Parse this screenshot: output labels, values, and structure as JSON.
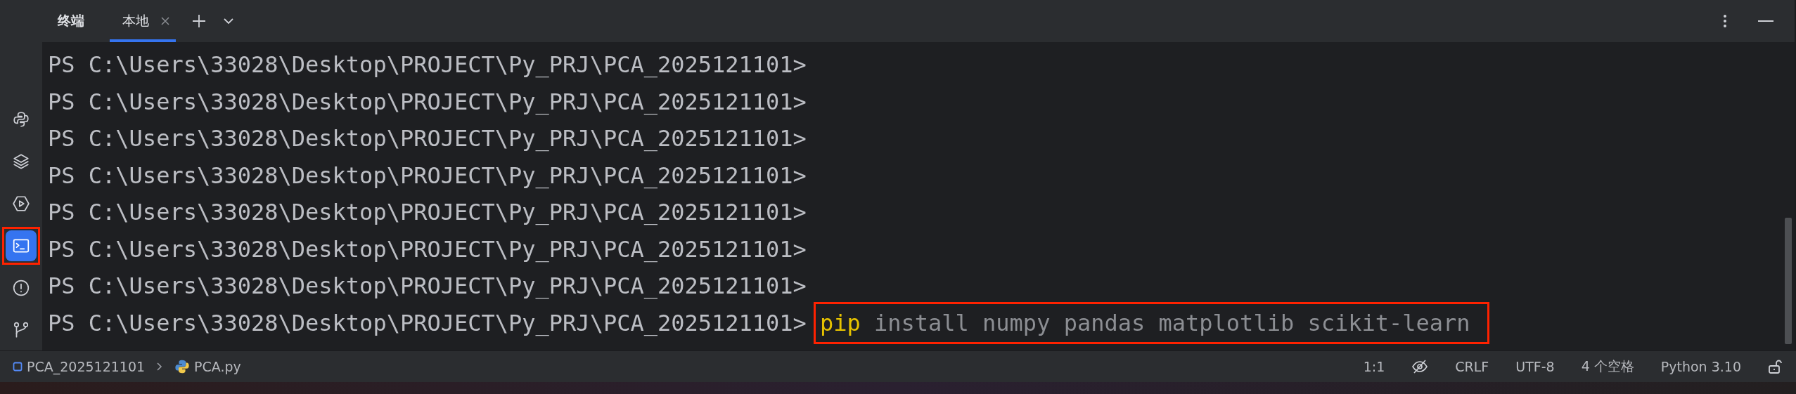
{
  "sidebar": {
    "items": [
      {
        "kind": "python",
        "selected": false
      },
      {
        "kind": "layers",
        "selected": false
      },
      {
        "kind": "run",
        "selected": false
      },
      {
        "kind": "terminal",
        "selected": true,
        "highlighted": true
      },
      {
        "kind": "problems",
        "selected": false
      },
      {
        "kind": "git",
        "selected": false
      }
    ]
  },
  "panel": {
    "title": "终端",
    "tabs": [
      {
        "label": "本地",
        "selected": true,
        "closable": true
      }
    ]
  },
  "terminal": {
    "lines": [
      {
        "prompt": "PS C:\\Users\\33028\\Desktop\\PROJECT\\Py_PRJ\\PCA_2025121101>"
      },
      {
        "prompt": "PS C:\\Users\\33028\\Desktop\\PROJECT\\Py_PRJ\\PCA_2025121101>"
      },
      {
        "prompt": "PS C:\\Users\\33028\\Desktop\\PROJECT\\Py_PRJ\\PCA_2025121101>"
      },
      {
        "prompt": "PS C:\\Users\\33028\\Desktop\\PROJECT\\Py_PRJ\\PCA_2025121101>"
      },
      {
        "prompt": "PS C:\\Users\\33028\\Desktop\\PROJECT\\Py_PRJ\\PCA_2025121101>"
      },
      {
        "prompt": "PS C:\\Users\\33028\\Desktop\\PROJECT\\Py_PRJ\\PCA_2025121101>"
      },
      {
        "prompt": "PS C:\\Users\\33028\\Desktop\\PROJECT\\Py_PRJ\\PCA_2025121101>"
      },
      {
        "prompt": "PS C:\\Users\\33028\\Desktop\\PROJECT\\Py_PRJ\\PCA_2025121101>",
        "command": {
          "program": "pip",
          "args": "install numpy pandas matplotlib scikit-learn"
        },
        "highlighted": true
      }
    ]
  },
  "status_bar": {
    "breadcrumb": [
      {
        "kind": "project",
        "label": "PCA_2025121101"
      },
      {
        "kind": "python-file",
        "label": "PCA.py"
      }
    ],
    "position": "1:1",
    "line_ending": "CRLF",
    "encoding": "UTF-8",
    "indent": "4 个空格",
    "interpreter": "Python 3.10"
  }
}
